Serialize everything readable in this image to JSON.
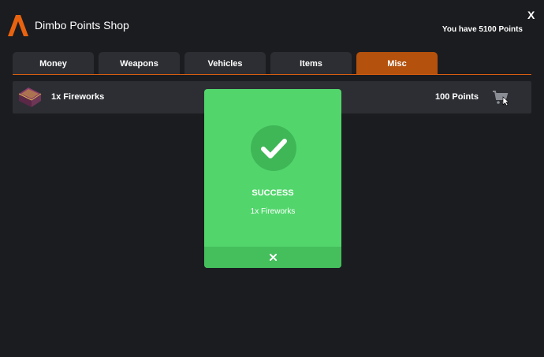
{
  "header": {
    "title": "Dimbo Points Shop",
    "close_label": "X",
    "balance": "You have 5100 Points",
    "logo_icon": "fivem-logo-icon"
  },
  "tabs": [
    {
      "label": "Money",
      "active": false
    },
    {
      "label": "Weapons",
      "active": false
    },
    {
      "label": "Vehicles",
      "active": false
    },
    {
      "label": "Items",
      "active": false
    },
    {
      "label": "Misc",
      "active": true
    }
  ],
  "items": [
    {
      "name": "1x Fireworks",
      "price": "100 Points",
      "icon": "fireworks-crate-icon",
      "action_icon": "cart-icon"
    }
  ],
  "modal": {
    "title": "SUCCESS",
    "message": "1x Fireworks",
    "icon": "checkmark-icon",
    "close_icon": "close-icon"
  },
  "colors": {
    "background": "#1b1c20",
    "panel": "#2c2e33",
    "accent": "#b4510d",
    "success": "#52d66c"
  }
}
